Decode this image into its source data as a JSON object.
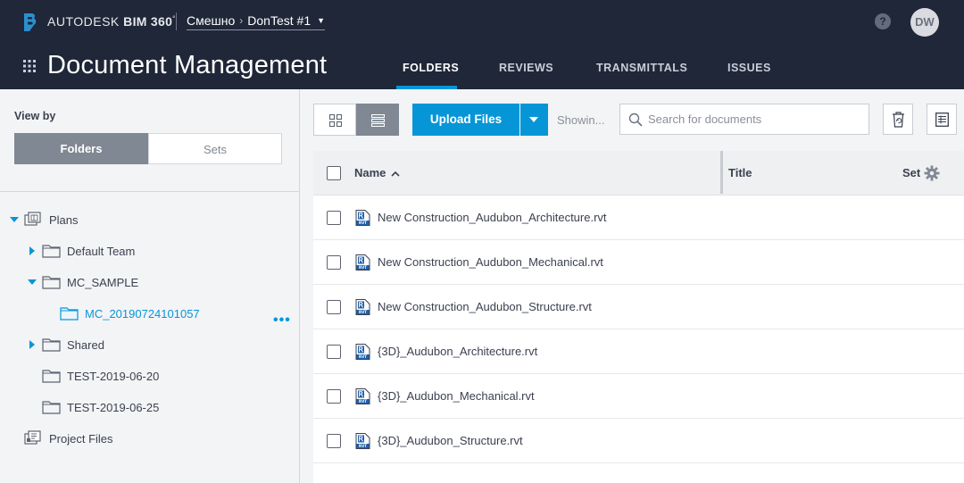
{
  "header": {
    "brand_prefix": "AUTODESK",
    "brand_product": "BIM 360",
    "brand_mark": "°",
    "breadcrumb": {
      "account": "Смешно",
      "project": "DonTest #1"
    },
    "help_label": "?",
    "avatar_initials": "DW",
    "page_title": "Document Management",
    "tabs": [
      {
        "label": "FOLDERS",
        "active": true
      },
      {
        "label": "REVIEWS",
        "active": false
      },
      {
        "label": "TRANSMITTALS",
        "active": false
      },
      {
        "label": "ISSUES",
        "active": false
      }
    ]
  },
  "sidebar": {
    "view_by_label": "View by",
    "folders_label": "Folders",
    "sets_label": "Sets",
    "tree": [
      {
        "label": "Plans",
        "expanded": true,
        "icon": "plans-icon"
      },
      {
        "label": "Default Team",
        "expanded": false,
        "icon": "folder-icon"
      },
      {
        "label": "MC_SAMPLE",
        "expanded": true,
        "icon": "folder-icon"
      },
      {
        "label": "MC_20190724101057",
        "selected": true,
        "icon": "folder-icon"
      },
      {
        "label": "Shared",
        "expanded": false,
        "icon": "folder-icon"
      },
      {
        "label": "TEST-2019-06-20",
        "icon": "folder-icon"
      },
      {
        "label": "TEST-2019-06-25",
        "icon": "folder-icon"
      },
      {
        "label": "Project Files",
        "icon": "project-files-icon"
      }
    ],
    "more_label": "•••"
  },
  "toolbar": {
    "upload_label": "Upload Files",
    "showing_label": "Showin...",
    "search_placeholder": "Search for documents"
  },
  "table": {
    "columns": {
      "name": "Name",
      "title": "Title",
      "set": "Set"
    },
    "sort": "name-ascending",
    "files": [
      "New Construction_Audubon_Architecture.rvt",
      "New Construction_Audubon_Mechanical.rvt",
      "New Construction_Audubon_Structure.rvt",
      "{3D}_Audubon_Architecture.rvt",
      "{3D}_Audubon_Mechanical.rvt",
      "{3D}_Audubon_Structure.rvt"
    ],
    "file_type_badge": "RVT"
  },
  "colors": {
    "header_bg": "#1f2738",
    "accent": "#0696d7",
    "selected_segment": "#808894"
  }
}
